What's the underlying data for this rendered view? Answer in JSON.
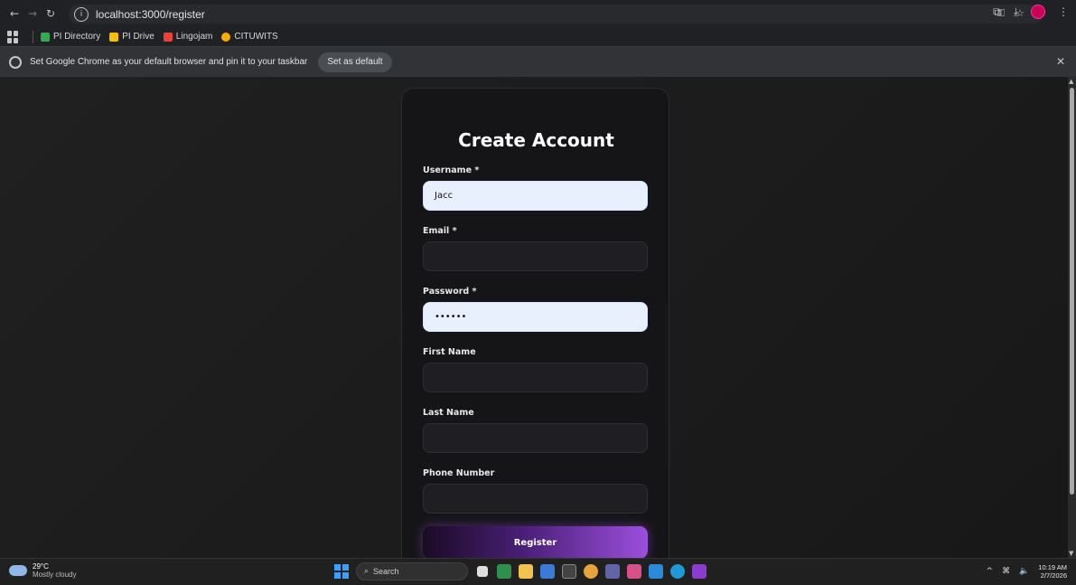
{
  "browser": {
    "url": "localhost:3000/register",
    "bookmarks": [
      {
        "label": "PI Directory",
        "color": "#34a853"
      },
      {
        "label": "PI Drive",
        "color": "#fbbc04"
      },
      {
        "label": "Lingojam",
        "color": "#ea4335"
      },
      {
        "label": "CITUWITS",
        "color": "#f9ab00"
      }
    ],
    "infobar": {
      "message": "Set Google Chrome as your default browser and pin it to your taskbar",
      "button": "Set as default"
    }
  },
  "form": {
    "title": "Create Account",
    "fields": [
      {
        "label": "Username *",
        "value": "Jacc",
        "filled": true
      },
      {
        "label": "Email *",
        "value": "",
        "filled": false
      },
      {
        "label": "Password *",
        "value": "••••••",
        "filled": true
      },
      {
        "label": "First Name",
        "value": "",
        "filled": false
      },
      {
        "label": "Last Name",
        "value": "",
        "filled": false
      },
      {
        "label": "Phone Number",
        "value": "",
        "filled": false
      }
    ],
    "submit_label": "Register"
  },
  "taskbar": {
    "weather_temp": "29°C",
    "weather_desc": "Mostly cloudy",
    "search_placeholder": "Search",
    "time": "10:19 AM",
    "date": "2/7/2026"
  },
  "colors": {
    "accent_start": "#1a0b24",
    "accent_end": "#9b4fdc",
    "card_bg": "#151517",
    "filled_input": "#e8f0fe"
  }
}
